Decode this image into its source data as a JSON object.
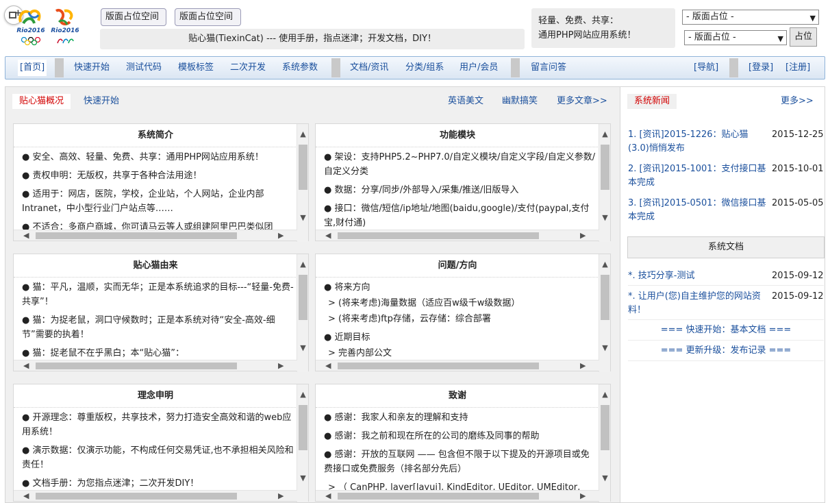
{
  "header": {
    "ad_button_1": "版面占位空间",
    "ad_button_2": "版面占位空间",
    "title": "贴心猫(TiexinCat) --- 使用手册，指点迷津；开发文档，DIY！",
    "slogan_line1": "轻量、免费、共享：",
    "slogan_line2": "通用PHP网站应用系统！",
    "select_1": "- 版面占位 -",
    "select_2": "- 版面占位 -",
    "go_button": "占位",
    "logo_1_text": "Rio2016",
    "logo_2_text": "Rio2016"
  },
  "nav": {
    "items": [
      "[首页]",
      "快速开始",
      "测试代码",
      "模板标签",
      "二次开发",
      "系统参数",
      "文档/资讯",
      "分类/组系",
      "用户/会员",
      "留言问答",
      "[导航]",
      "[登录]",
      "[注册]"
    ]
  },
  "tabs": {
    "items": [
      "贴心猫概况",
      "快速开始",
      "英语美文",
      "幽默搞笑",
      "更多文章>>"
    ]
  },
  "panels": [
    {
      "title": "系统简介",
      "lines": [
        "● 安全、高效、轻量、免费、共享：通用PHP网站应用系统！",
        "● 责权申明：无版权，共享于各种合法用途！",
        "● 适用于：网店，医院，学校，企业站，个人网站，企业内部Intranet，中小型行业门户站点等……",
        "● 不适合：多商户商城，你可请马云等人或组建阿里巴巴类似团"
      ]
    },
    {
      "title": "功能模块",
      "lines": [
        "● 架设：支持PHP5.2~PHP7.0/自定义模块/自定义字段/自定义参数/自定义分类",
        "● 数据：分享/同步/外部导入/采集/推送/旧版导入",
        "● 接口：微信/短信/ip地址/地图(baidu,google)/支付(paypal,支付宝,财付通)"
      ]
    },
    {
      "title": "贴心猫由来",
      "lines": [
        "● 猫：平凡，温顺，实而无华；正是本系统追求的目标---“轻量-免费-共享”！",
        "● 猫：为捉老鼠，洞口守候数时；正是本系统对待“安全-高效-细节”需要的执着！",
        "● 猫：捉老鼠不在乎黑白；本“贴心猫”："
      ]
    },
    {
      "title": "问题/方向",
      "lines": [
        "● 将来方向",
        "> (将来考虑)海量数据（适应百w级千w级数据）",
        "> (将来考虑)ftp存储，云存储：综合部署",
        "● 近期目标",
        "> 完善内部公文"
      ]
    },
    {
      "title": "理念申明",
      "lines": [
        "● 开源理念：尊重版权，共享技术，努力打造安全高效和谐的web应用系统！",
        "● 演示数据：仅演示功能，不构成任何交易凭证,也不承担相关风险和责任！",
        "● 文档手册：为您指点迷津；二次开发DIY！"
      ]
    },
    {
      "title": "致谢",
      "lines": [
        "● 感谢：我家人和亲友的理解和支持",
        "● 感谢：我之前和现在所在的公司的磨练及同事的帮助",
        "● 感谢：开放的互联网 —— 包含但不限于以下提及的开源项目或免费接口或免费服务（排名部分先后）",
        "> （ CanPHP, layer[layui], KindEditor, UEditor, UMEditor,"
      ]
    }
  ],
  "sidebar": {
    "news_title": "系统新闻",
    "news_more": "更多>>",
    "news": [
      {
        "title": "1. [资讯]2015-1226：贴心猫(3.0)悄悄发布",
        "date": "2015-12-25"
      },
      {
        "title": "2. [资讯]2015-1001：支付接口基本完成",
        "date": "2015-10-01"
      },
      {
        "title": "3. [资讯]2015-0501：微信接口基本完成",
        "date": "2015-05-05"
      }
    ],
    "docs_title": "系统文档",
    "docs": [
      {
        "title": "*. 技巧分享-测试",
        "date": "2015-09-12"
      },
      {
        "title": "*. 让用户(您)自主维护您的网站资料！",
        "date": "2015-09-12"
      }
    ],
    "quick_link": "=== 快速开始：基本文档 ===",
    "upgrade_link": "=== 更新升级：发布记录 ==="
  },
  "colors": {
    "link": "#1a4f9c",
    "active": "#d20000",
    "nav_border": "#8fb3d9"
  }
}
